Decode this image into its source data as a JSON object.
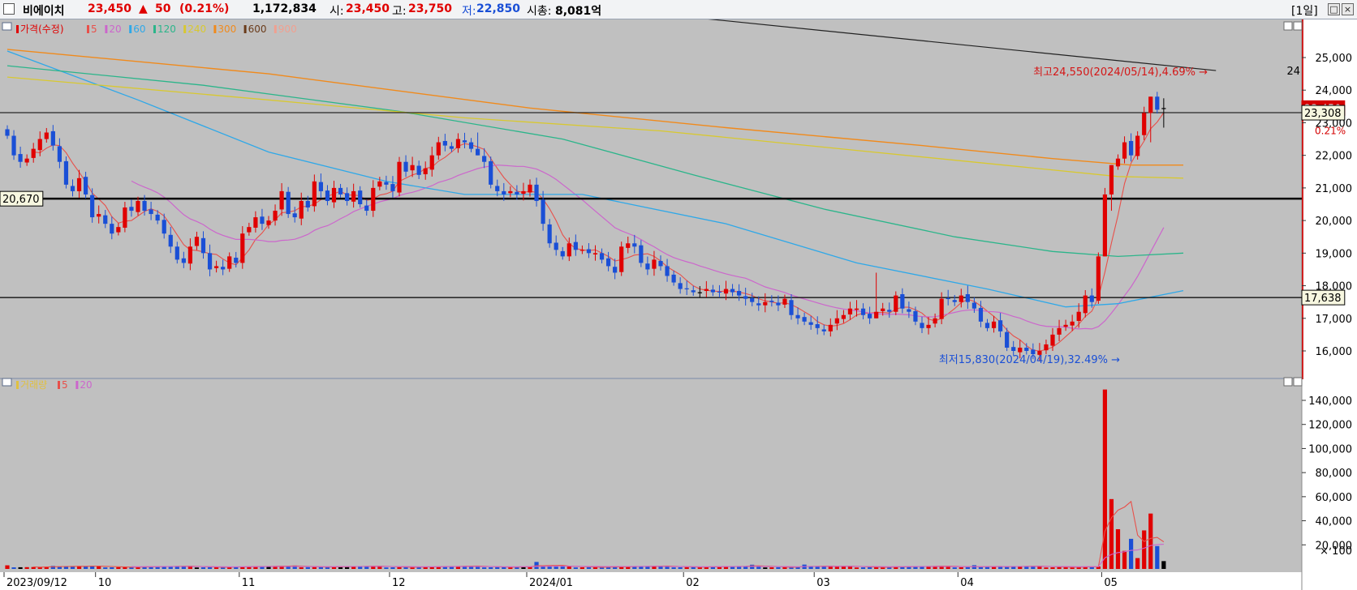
{
  "header": {
    "name": "비에이치",
    "price": "23,450",
    "change_arrow": "▲",
    "change": "50",
    "change_pct": "(0.21%)",
    "volume": "1,172,834",
    "open_label": "시:",
    "open": "23,450",
    "high_label": "고:",
    "high": "23,750",
    "low_label": "저:",
    "low": "22,850",
    "mktcap_label": "시총:",
    "mktcap": "8,081억",
    "period": "[1일]",
    "colors": {
      "up": "#e00000",
      "down": "#1a4fd6",
      "text": "#000000"
    }
  },
  "chart_data": [
    {
      "type": "candlestick",
      "legend": [
        {
          "label": "가격(수정)",
          "color": "#e00000"
        },
        {
          "label": "5",
          "color": "#e8504a"
        },
        {
          "label": "20",
          "color": "#cc66cc"
        },
        {
          "label": "60",
          "color": "#2fa8e8"
        },
        {
          "label": "120",
          "color": "#2bb58a"
        },
        {
          "label": "240",
          "color": "#d8c830"
        },
        {
          "label": "300",
          "color": "#f08a1c"
        },
        {
          "label": "600",
          "color": "#6a3b1a"
        },
        {
          "label": "900",
          "color": "#f0a090"
        }
      ],
      "ylim": [
        15500,
        25700
      ],
      "yticks": [
        16000,
        17000,
        18000,
        19000,
        20000,
        21000,
        22000,
        23000,
        24000,
        25000
      ],
      "ytick_labels": [
        "16,000",
        "17,000",
        "18,000",
        "19,000",
        "20,000",
        "21,000",
        "22,000",
        "23,000",
        "24,000",
        "25,000"
      ],
      "x_labels": [
        {
          "label": "2023/09/12",
          "i": 0
        },
        {
          "label": "10",
          "i": 14
        },
        {
          "label": "11",
          "i": 36
        },
        {
          "label": "12",
          "i": 59
        },
        {
          "label": "2024/01",
          "i": 80
        },
        {
          "label": "02",
          "i": 104
        },
        {
          "label": "03",
          "i": 124
        },
        {
          "label": "04",
          "i": 146
        },
        {
          "label": "05",
          "i": 168
        }
      ],
      "horizontal_lines": [
        {
          "value": 23308,
          "label": "23,308",
          "weight": 1
        },
        {
          "value": 20670,
          "label": "20,670",
          "weight": 2.5
        },
        {
          "value": 17638,
          "label": "17,638",
          "weight": 1.3
        }
      ],
      "last_price_label": "23,450",
      "last_pct_label": "0.21%",
      "trendline_end_label": "24",
      "annotations": [
        {
          "text": "최고24,550(2024/05/14),4.69%",
          "value": 24550
        },
        {
          "text": "최저15,830(2024/04/19),32.49%",
          "value": 15830
        }
      ],
      "closes": [
        22600,
        22000,
        21800,
        21900,
        22200,
        22500,
        22700,
        22300,
        21800,
        21100,
        20900,
        21300,
        20800,
        20100,
        20200,
        19900,
        19600,
        19800,
        20400,
        20300,
        20600,
        20300,
        20200,
        20000,
        19600,
        19200,
        18800,
        18700,
        19200,
        19500,
        19000,
        18500,
        18600,
        18500,
        18900,
        18700,
        19600,
        19800,
        20100,
        19900,
        20000,
        20300,
        20900,
        20200,
        20100,
        20600,
        20400,
        21200,
        20900,
        20600,
        21000,
        20800,
        20600,
        20900,
        20500,
        20300,
        21000,
        21200,
        21100,
        20900,
        21800,
        21500,
        21700,
        21400,
        21600,
        22000,
        22400,
        22300,
        22200,
        22500,
        22400,
        22200,
        22000,
        21800,
        21100,
        20900,
        20800,
        20900,
        20800,
        20900,
        21100,
        20600,
        19900,
        19300,
        19100,
        18900,
        19300,
        19100,
        19100,
        19000,
        19000,
        18800,
        18600,
        18400,
        19200,
        19300,
        19200,
        18700,
        18500,
        18800,
        18600,
        18300,
        18100,
        17900,
        17900,
        17800,
        17800,
        17900,
        17800,
        17800,
        17900,
        17800,
        17700,
        17600,
        17500,
        17400,
        17500,
        17500,
        17400,
        17600,
        17100,
        17000,
        16900,
        16800,
        16700,
        16600,
        16800,
        17000,
        17100,
        17300,
        17300,
        17100,
        17000,
        17200,
        17300,
        17200,
        17700,
        17300,
        17200,
        16900,
        16700,
        16800,
        17000,
        17600,
        17600,
        17500,
        17700,
        17500,
        17300,
        16900,
        16700,
        16900,
        16600,
        16100,
        16000,
        16100,
        16000,
        15900,
        16000,
        16200,
        16500,
        16700,
        16800,
        16900,
        17200,
        17700,
        17500,
        18900,
        20800,
        21700,
        21900,
        22400,
        22000,
        22600,
        23300,
        23800,
        23400,
        23450
      ],
      "extras": {
        "72": [
          22700,
          22100
        ],
        "133": [
          18400,
          17200
        ],
        "168": [
          21000,
          18900
        ],
        "169": [
          21200,
          20300
        ],
        "175": [
          23800,
          22400
        ]
      },
      "moving_averages": [
        {
          "period": 5,
          "color": "#e8504a",
          "start": 4,
          "stroke": 1.1
        },
        {
          "period": 20,
          "color": "#cc66cc",
          "start": 19,
          "stroke": 1.2
        },
        {
          "period": 60,
          "color": "#2fa8e8",
          "path": [
            [
              0,
              25200
            ],
            [
              20,
              23700
            ],
            [
              40,
              22100
            ],
            [
              58,
              21200
            ],
            [
              70,
              20800
            ],
            [
              88,
              20800
            ],
            [
              110,
              19900
            ],
            [
              130,
              18700
            ],
            [
              150,
              17900
            ],
            [
              162,
              17350
            ],
            [
              170,
              17450
            ],
            [
              180,
              17850
            ]
          ],
          "stroke": 1.3
        },
        {
          "period": 120,
          "color": "#2bb58a",
          "path": [
            [
              0,
              24750
            ],
            [
              30,
              24150
            ],
            [
              60,
              23350
            ],
            [
              85,
              22500
            ],
            [
              105,
              21400
            ],
            [
              125,
              20350
            ],
            [
              145,
              19500
            ],
            [
              160,
              19050
            ],
            [
              170,
              18900
            ],
            [
              180,
              19000
            ]
          ],
          "stroke": 1.3
        },
        {
          "period": 240,
          "color": "#d8c830",
          "path": [
            [
              0,
              24400
            ],
            [
              40,
              23700
            ],
            [
              70,
              23150
            ],
            [
              100,
              22750
            ],
            [
              130,
              22150
            ],
            [
              155,
              21650
            ],
            [
              170,
              21350
            ],
            [
              180,
              21300
            ]
          ],
          "stroke": 1.3
        },
        {
          "period": 300,
          "color": "#f08a1c",
          "path": [
            [
              0,
              25250
            ],
            [
              40,
              24500
            ],
            [
              80,
              23450
            ],
            [
              110,
              22850
            ],
            [
              140,
              22300
            ],
            [
              160,
              21900
            ],
            [
              172,
              21700
            ],
            [
              180,
              21700
            ]
          ],
          "stroke": 1.4
        }
      ],
      "trendline": [
        [
          104,
          26250
        ],
        [
          185,
          24600
        ]
      ]
    },
    {
      "type": "bar",
      "legend": [
        {
          "label": "거래량",
          "color": "#e0c040"
        },
        {
          "label": "5",
          "color": "#e8504a"
        },
        {
          "label": "20",
          "color": "#cc66cc"
        }
      ],
      "unit": "× 100",
      "ylim": [
        0,
        155000
      ],
      "yticks": [
        20000,
        40000,
        60000,
        80000,
        100000,
        120000,
        140000
      ],
      "ytick_labels": [
        "20,000",
        "40,000",
        "60,000",
        "80,000",
        "100,000",
        "120,000",
        "140,000"
      ],
      "spikes": {
        "0": 3000,
        "7": 2500,
        "44": 2800,
        "81": 5800,
        "114": 3500,
        "122": 3600,
        "148": 3100,
        "168": 149000,
        "169": 58000,
        "170": 33000,
        "171": 15000,
        "172": 25000,
        "173": 9000,
        "174": 32000,
        "175": 46000,
        "176": 19000,
        "177": 6500
      },
      "black_bars": [
        2,
        29,
        40,
        51,
        52,
        79,
        116,
        177
      ]
    }
  ]
}
